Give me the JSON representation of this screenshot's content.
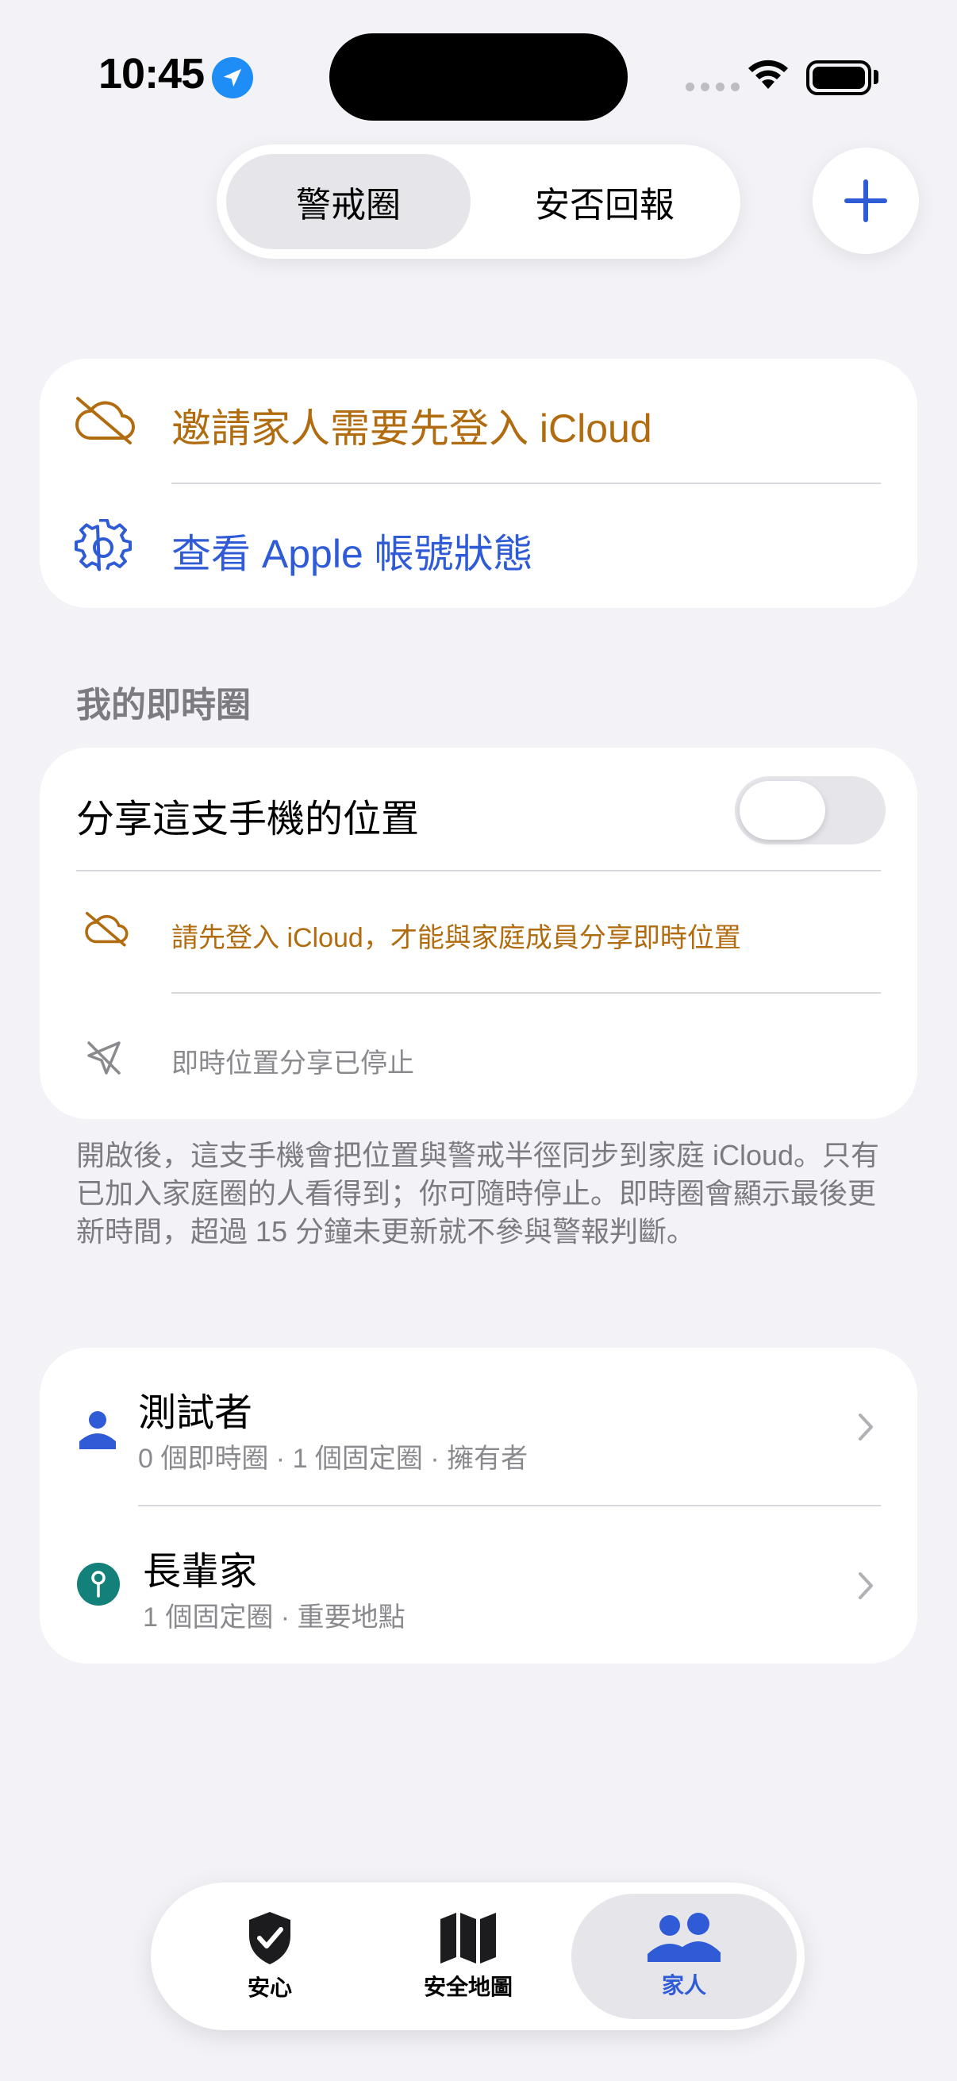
{
  "status_bar": {
    "time": "10:45"
  },
  "segmented": {
    "active": "警戒圈",
    "inactive": "安否回報"
  },
  "icloud_card": {
    "invite_label": "邀請家人需要先登入 iCloud",
    "account_label": "查看 Apple 帳號狀態"
  },
  "live_circle": {
    "header": "我的即時圈",
    "share_label": "分享這支手機的位置",
    "share_enabled": false,
    "icloud_notice": "請先登入 iCloud，才能與家庭成員分享即時位置",
    "stopped_notice": "即時位置分享已停止",
    "footnote": "開啟後，這支手機會把位置與警戒半徑同步到家庭 iCloud。只有已加入家庭圈的人看得到；你可隨時停止。即時圈會顯示最後更新時間，超過 15 分鐘未更新就不參與警報判斷。"
  },
  "people": [
    {
      "name": "測試者",
      "detail": "0 個即時圈 · 1 個固定圈 · 擁有者"
    },
    {
      "name": "長輩家",
      "detail": "1 個固定圈 · 重要地點"
    }
  ],
  "tabbar": {
    "tabs": [
      {
        "label": "安心"
      },
      {
        "label": "安全地圖"
      },
      {
        "label": "家人"
      }
    ],
    "active_index": 2
  },
  "colors": {
    "accent_blue": "#2f5bd6",
    "warning_orange": "#b16c10",
    "teal": "#13807a"
  }
}
